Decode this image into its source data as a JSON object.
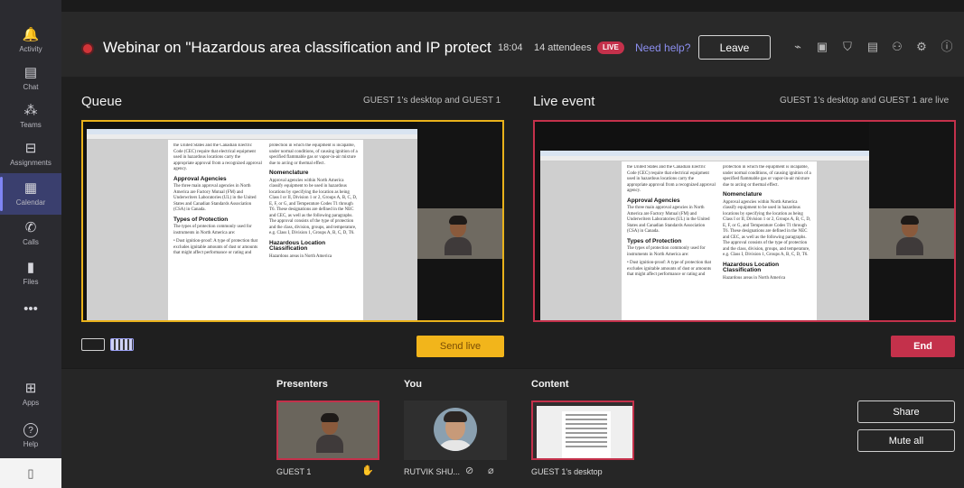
{
  "rail": {
    "items": [
      {
        "label": "Activity",
        "glyph": "🔔"
      },
      {
        "label": "Chat",
        "glyph": "▤"
      },
      {
        "label": "Teams",
        "glyph": "⁂"
      },
      {
        "label": "Assignments",
        "glyph": "⊟"
      },
      {
        "label": "Calendar",
        "glyph": "▦"
      },
      {
        "label": "Calls",
        "glyph": "✆"
      },
      {
        "label": "Files",
        "glyph": "▮"
      },
      {
        "label": "",
        "glyph": "•••"
      }
    ],
    "bottom": [
      {
        "label": "Apps",
        "glyph": "⊞"
      },
      {
        "label": "Help",
        "glyph": "?"
      }
    ]
  },
  "header": {
    "title": "Webinar on \"Hazardous area classification and IP protection in Ind...",
    "timer": "18:04",
    "attendees": "14 attendees",
    "live_badge": "LIVE",
    "help": "Need help?",
    "leave": "Leave",
    "icons": [
      "activity-icon",
      "notes-icon",
      "shield-icon",
      "chat-icon",
      "participants-icon",
      "settings-icon",
      "info-icon"
    ]
  },
  "queue": {
    "title": "Queue",
    "subtitle": "GUEST 1's desktop and GUEST 1",
    "send_live": "Send live"
  },
  "live": {
    "title": "Live event",
    "subtitle": "GUEST 1's desktop and GUEST 1 are live",
    "end": "End"
  },
  "document": {
    "left_col": {
      "intro": "the United States and the Canadian Electric Code (CEC) require that electrical equipment used in hazardous locations carry the appropriate approval from a recognized approval agency.",
      "h1": "Approval Agencies",
      "p1": "The three main approval agencies in North America are Factory Mutual (FM) and Underwriters Laboratories (UL) in the United States and Canadian Standards Association (CSA) in Canada.",
      "h2": "Types of Protection",
      "p2": "The types of protection commonly used for instruments in North America are:",
      "p3": "• Dust ignition-proof: A type of protection that excludes ignitable amounts of dust or amounts that might affect performance or rating and"
    },
    "right_col": {
      "intro": "protection in which the equipment is incapable, under normal conditions, of causing ignition of a specified flammable gas or vapor-in-air mixture due to arcing or thermal effect.",
      "h1": "Nomenclature",
      "p1": "Approval agencies within North America classify equipment to be used in hazardous locations by specifying the location as being Class I or II, Division 1 or 2, Groups A, B, C, D, E, F, or G, and Temperature Codes T1 through T6. These designations are defined in the NEC and CEC, as well as the following paragraphs. The approval consists of the type of protection and the class, division, groups, and temperature, e.g. Class I, Division 1, Groups A, B, C, D, T6.",
      "h2": "Hazardous Location Classification",
      "p2": "Hazardous areas in North America"
    }
  },
  "tray": {
    "presenters_label": "Presenters",
    "you_label": "You",
    "content_label": "Content",
    "presenter_name": "GUEST 1",
    "you_name": "RUTVIK SHU...",
    "content_name": "GUEST 1's desktop",
    "share": "Share",
    "mute_all": "Mute all"
  },
  "colors": {
    "queue_border": "#e9b21b",
    "live_border": "#c4314b",
    "accent": "#7f85f5"
  }
}
